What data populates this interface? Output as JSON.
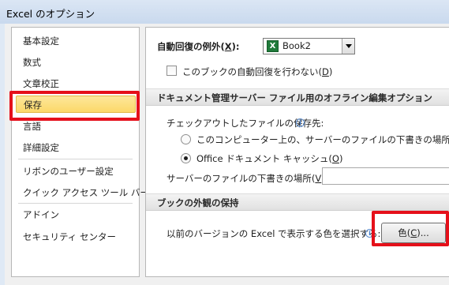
{
  "window": {
    "title": "Excel のオプション"
  },
  "sidebar": {
    "items": [
      {
        "label": "基本設定"
      },
      {
        "label": "数式"
      },
      {
        "label": "文章校正"
      },
      {
        "label": "保存",
        "selected": true
      },
      {
        "label": "言語"
      },
      {
        "label": "詳細設定"
      },
      {
        "label": "リボンのユーザー設定"
      },
      {
        "label": "クイック アクセス ツール バー"
      },
      {
        "label": "アドイン"
      },
      {
        "label": "セキュリティ センター"
      }
    ]
  },
  "autorecover": {
    "label": "自動回復の例外(",
    "key": "X",
    "suffix": "):",
    "selected_workbook": "Book2",
    "disable_checkbox": {
      "label": "このブックの自動回復を行わない(",
      "key": "D",
      "suffix": ")",
      "checked": false
    }
  },
  "offline_section": {
    "header": "ドキュメント管理サーバー ファイル用のオフライン編集オプション",
    "save_location_label": "チェックアウトしたファイルの保存先:",
    "option_server_drafts": {
      "label": "このコンピューター上の、サーバーのファイルの下書きの場所(",
      "key": "L",
      "suffix": ")",
      "checked": false
    },
    "option_office_cache": {
      "label": "Office ドキュメント キャッシュ(",
      "key": "O",
      "suffix": ")",
      "checked": true
    },
    "drafts_location_label": "サーバーのファイルの下書きの場所(",
    "drafts_location_key": "V",
    "drafts_location_suffix": "):",
    "drafts_location_value": ""
  },
  "appearance_section": {
    "header": "ブックの外観の保持",
    "colors_label": "以前のバージョンの Excel で表示する色を選択する:",
    "colors_button": {
      "label": "色(",
      "key": "C",
      "suffix": ")..."
    }
  },
  "colors": {
    "highlight": "#e5101a",
    "selected_item_bg": "#fcd869",
    "excel_green": "#1f7a3a"
  }
}
